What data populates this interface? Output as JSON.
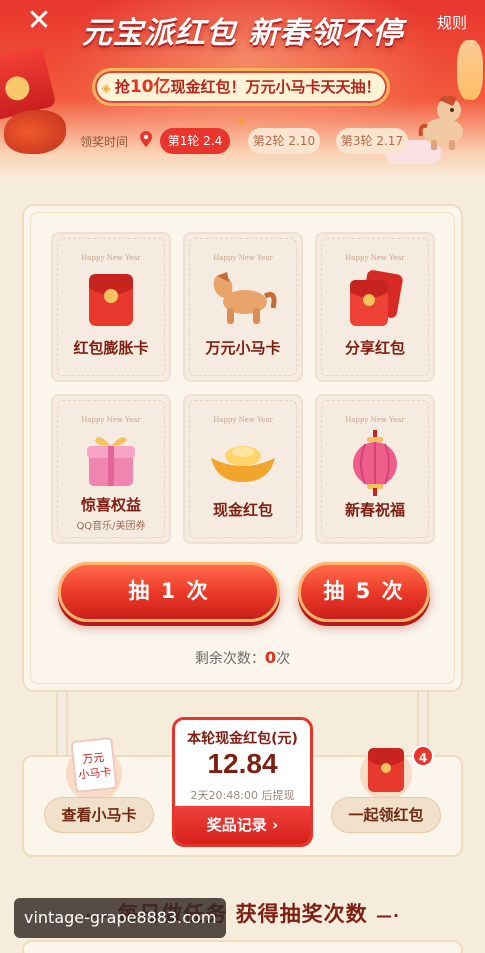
{
  "header": {
    "close_symbol": "✕",
    "rules_label": "规则",
    "title": "元宝派红包 新春领不停",
    "banner": {
      "prefix": "抢",
      "highlight": "10亿",
      "suffix": "现金红包！万元小马卡天天抽！"
    },
    "award_label": "领奖时间",
    "rounds": [
      {
        "label": "第1轮 2.4",
        "active": true
      },
      {
        "label": "第2轮 2.10",
        "active": false
      },
      {
        "label": "第3轮 2.17",
        "active": false
      }
    ]
  },
  "prizes": {
    "card_caption": "Happy New Year",
    "items": [
      {
        "label": "红包膨胀卡",
        "sub": "",
        "icon": "red-envelope-icon"
      },
      {
        "label": "万元小马卡",
        "sub": "",
        "icon": "pony-icon"
      },
      {
        "label": "分享红包",
        "sub": "",
        "icon": "red-envelopes-icon"
      },
      {
        "label": "惊喜权益",
        "sub": "QQ音乐/美团券",
        "icon": "gift-box-icon"
      },
      {
        "label": "现金红包",
        "sub": "",
        "icon": "gold-ingot-icon"
      },
      {
        "label": "新春祝福",
        "sub": "",
        "icon": "lantern-icon"
      }
    ]
  },
  "draw": {
    "draw_one": "抽 1 次",
    "draw_five": "抽 5 次",
    "remaining_label": "剩余次数：",
    "remaining_count": "0",
    "remaining_unit": "次"
  },
  "bottom": {
    "pony_card_text": "万元\n小马卡",
    "view_pony_card": "查看小马卡",
    "center_title": "本轮现金红包(元)",
    "center_amount": "12.84",
    "center_time": "2天20:48:00 后提现",
    "records_label": "奖品记录",
    "records_chevron": "›",
    "collect_together": "一起领红包",
    "badge_count": "4"
  },
  "tasks": {
    "title": "每日做任务 获得抽奖次数",
    "dash_left": "·—",
    "dash_right": "—·"
  },
  "watermark": "vintage-grape8883.com",
  "colors": {
    "primary_red": "#e8352d",
    "dark_red_text": "#7d1f12",
    "cream_bg": "#f6ecdc",
    "gold_border": "#efdcbd"
  }
}
